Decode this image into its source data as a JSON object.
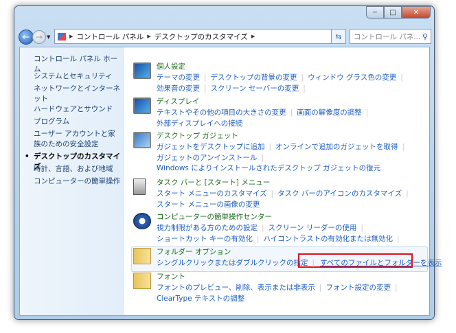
{
  "window": {
    "minimize": "─",
    "maximize": "□",
    "close": "✕"
  },
  "address": {
    "crumbs": [
      "コントロール パネル",
      "デスクトップのカスタマイズ"
    ],
    "search_placeholder": "コントロール パネ..."
  },
  "sidebar": {
    "home": "コントロール パネル ホーム",
    "items": [
      "システムとセキュリティ",
      "ネットワークとインターネット",
      "ハードウェアとサウンド",
      "プログラム",
      "ユーザー アカウントと家族のための安全設定",
      "デスクトップのカスタマイズ",
      "時計、言語、および地域",
      "コンピューターの簡単操作"
    ],
    "bullet": "•"
  },
  "sections": [
    {
      "title": "個人設定",
      "links": [
        [
          "テーマの変更",
          "デスクトップの背景の変更",
          "ウィンドウ グラス色の変更"
        ],
        [
          "効果音の変更",
          "スクリーン セーバーの変更"
        ]
      ]
    },
    {
      "title": "ディスプレイ",
      "links": [
        [
          "テキストやその他の項目の大きさの変更",
          "画面の解像度の調整"
        ],
        [
          "外部ディスプレイへの接続"
        ]
      ]
    },
    {
      "title": "デスクトップ ガジェット",
      "links": [
        [
          "ガジェットをデスクトップに追加",
          "オンラインで追加のガジェットを取得"
        ],
        [
          "ガジェットのアンインストール"
        ],
        [
          "Windows によりインストールされたデスクトップ ガジェットの復元"
        ]
      ]
    },
    {
      "title": "タスク バーと [スタート] メニュー",
      "links": [
        [
          "スタート メニューのカスタマイズ",
          "タスク バーのアイコンのカスタマイズ"
        ],
        [
          "スタート メニューの画像の変更"
        ]
      ]
    },
    {
      "title": "コンピューターの簡単操作センター",
      "links": [
        [
          "視力制限がある方のための設定",
          "スクリーン リーダーの使用"
        ],
        [
          "ショートカット キーの有効化",
          "ハイコントラストの有効化または無効化"
        ]
      ]
    },
    {
      "title": "フォルダー オプション",
      "links": [
        [
          "シングルクリックまたはダブルクリックの指定",
          "すべてのファイルとフォルダーを表示"
        ]
      ]
    },
    {
      "title": "フォント",
      "links": [
        [
          "フォントのプレビュー、削除、表示または非表示",
          "フォント設定の変更"
        ],
        [
          "ClearType テキストの調整"
        ]
      ]
    }
  ]
}
